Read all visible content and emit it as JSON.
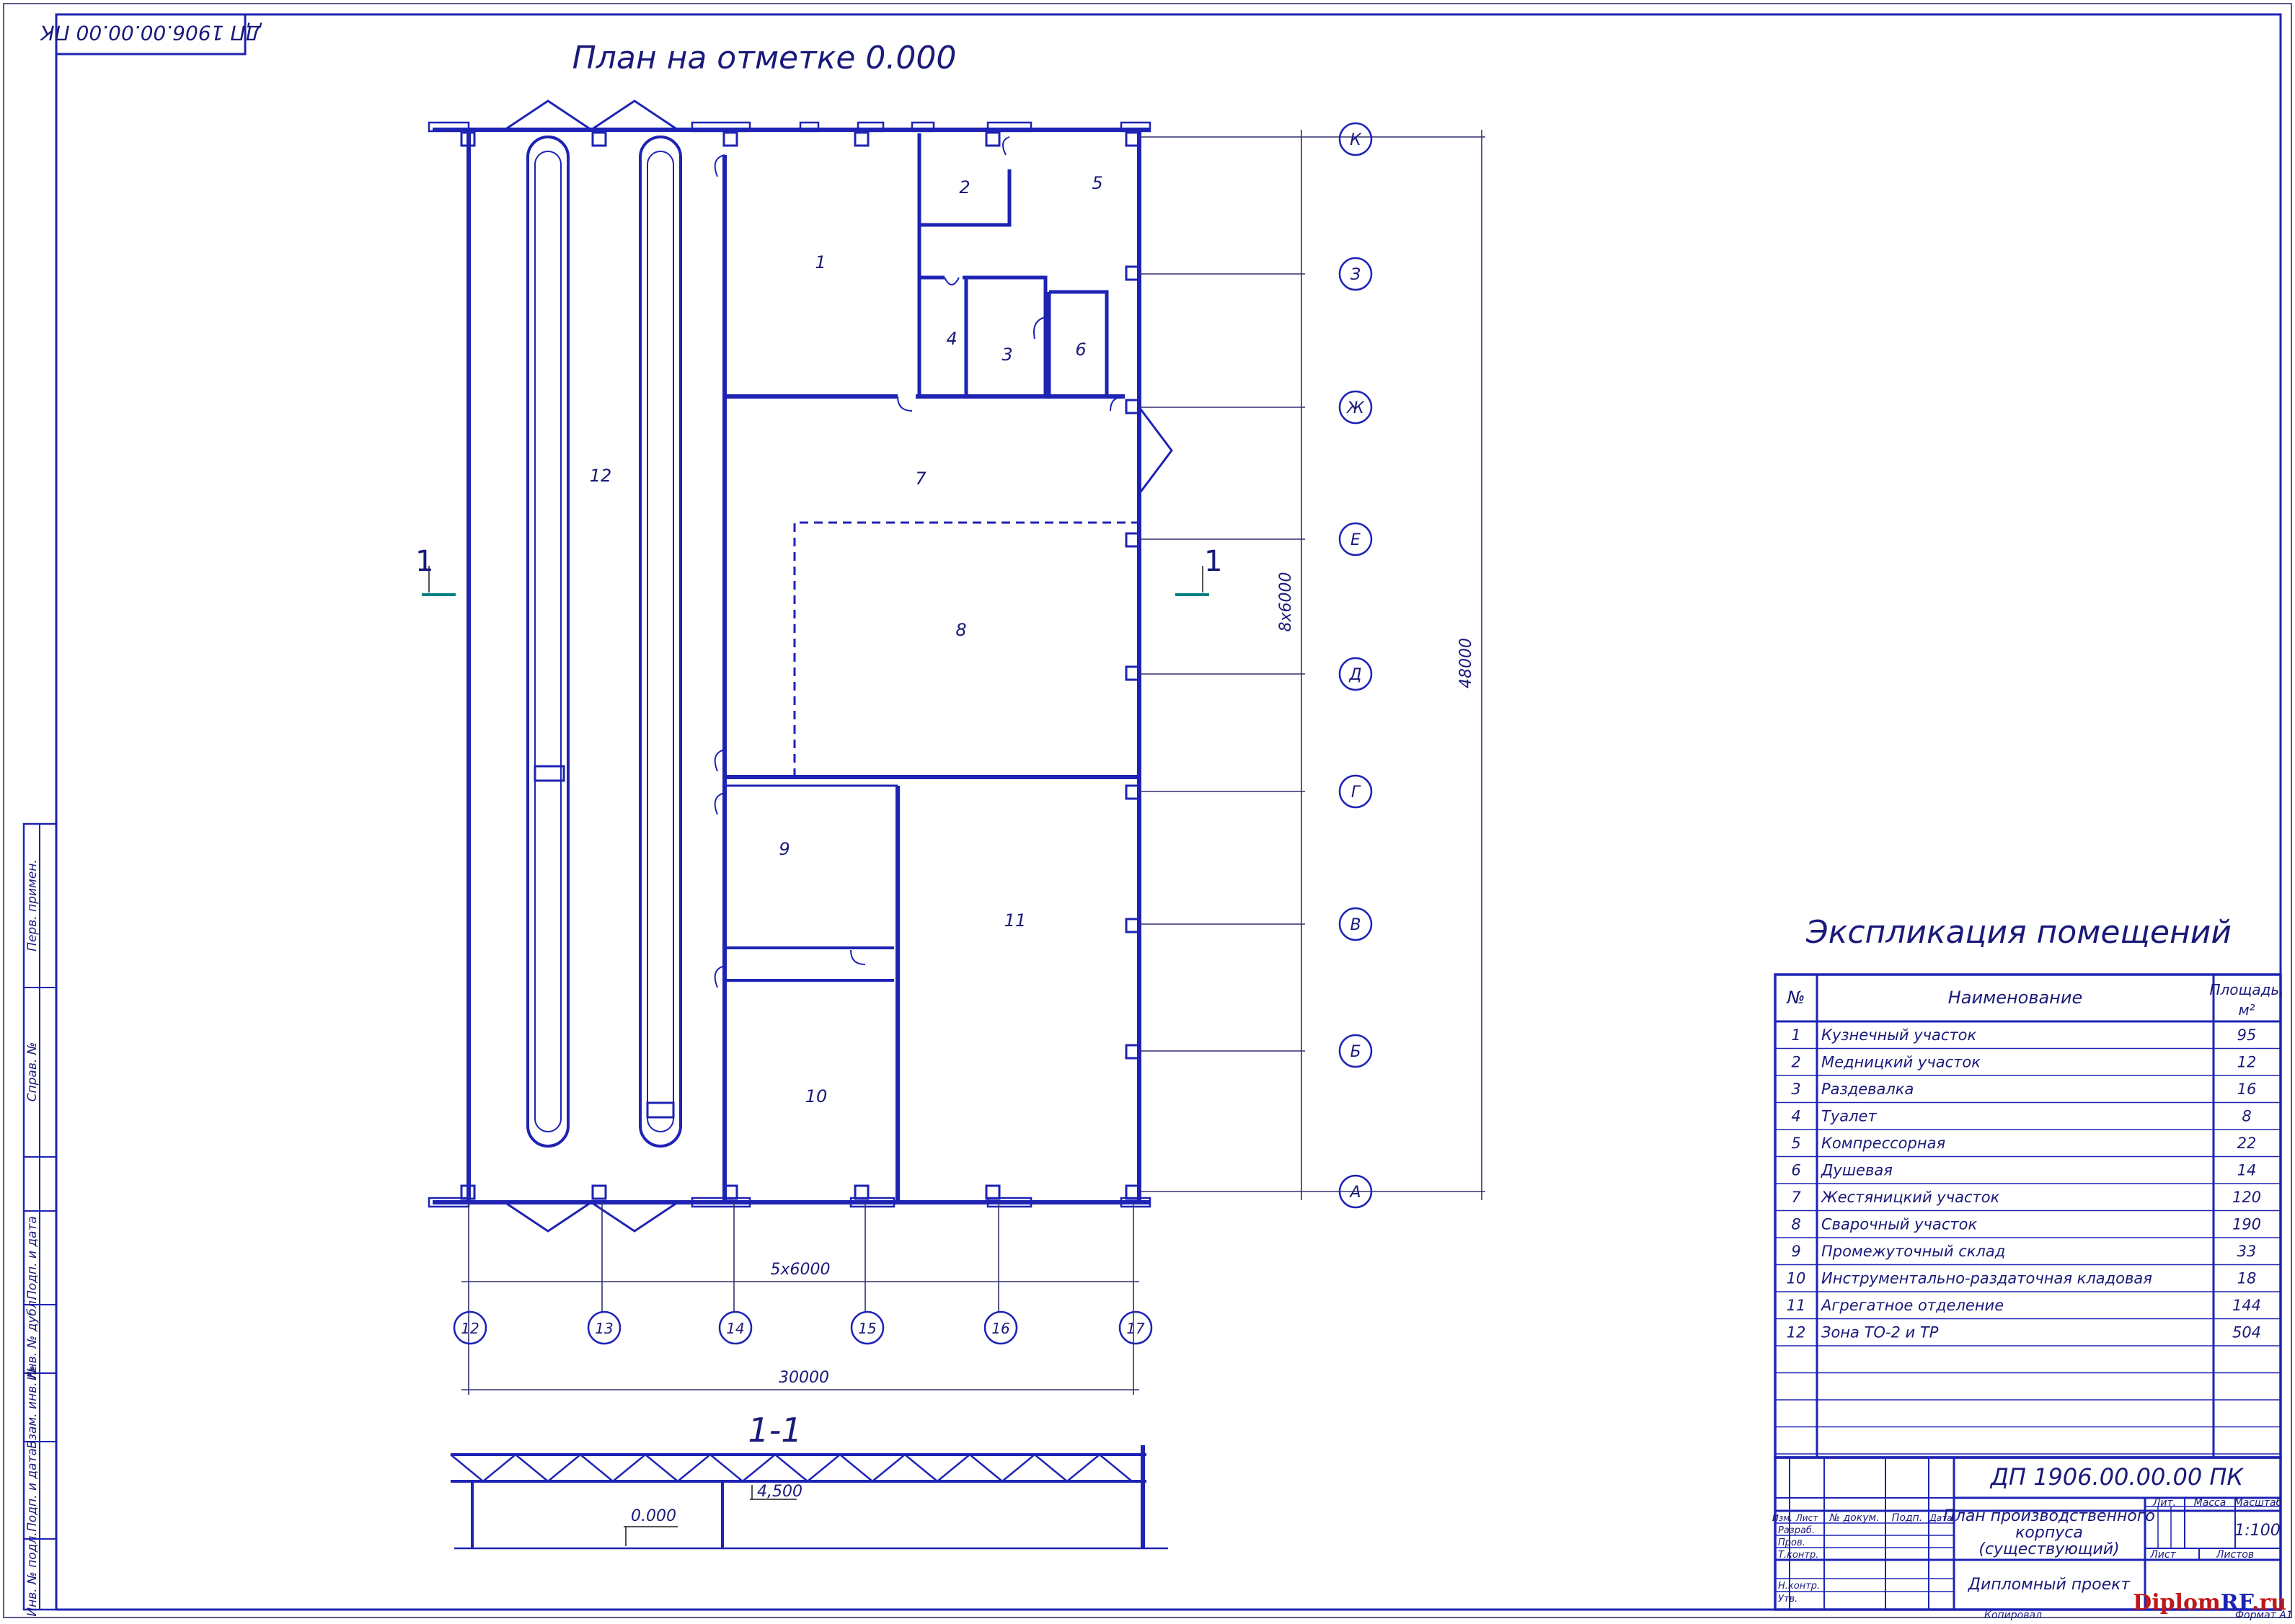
{
  "stamp_top": "ДП 1906.00.00.00 ПК",
  "plan_title": "План на отметке 0.000",
  "section_title": "1-1",
  "section_marks": {
    "left": "1",
    "right": "1"
  },
  "rooms": [
    "1",
    "2",
    "3",
    "4",
    "5",
    "6",
    "7",
    "8",
    "9",
    "10",
    "11",
    "12"
  ],
  "axes_letters": [
    "К",
    "З",
    "Ж",
    "Е",
    "Д",
    "Г",
    "В",
    "Б",
    "А"
  ],
  "axes_numbers": [
    "12",
    "13",
    "14",
    "15",
    "16",
    "17"
  ],
  "dimensions": {
    "span_step": "5х6000",
    "span_total": "30000",
    "height_step": "8х6000",
    "height_total": "48000"
  },
  "levels": {
    "floor": "0.000",
    "top": "4,500"
  },
  "side_stamps": [
    "Перв. примен.",
    "Справ. №",
    "Подп. и дата",
    "Инв. № дубл.",
    "Взам. инв. №",
    "Подп. и дата",
    "Инв. № подл."
  ],
  "explication": {
    "title": "Экспликация помещений",
    "headers": {
      "no": "№",
      "name": "Наименование",
      "area": "Площадь, м²"
    },
    "rows": [
      {
        "no": "1",
        "name": "Кузнечный участок",
        "area": "95"
      },
      {
        "no": "2",
        "name": "Медницкий участок",
        "area": "12"
      },
      {
        "no": "3",
        "name": "Раздевалка",
        "area": "16"
      },
      {
        "no": "4",
        "name": "Туалет",
        "area": "8"
      },
      {
        "no": "5",
        "name": "Компрессорная",
        "area": "22"
      },
      {
        "no": "6",
        "name": "Душевая",
        "area": "14"
      },
      {
        "no": "7",
        "name": "Жестяницкий участок",
        "area": "120"
      },
      {
        "no": "8",
        "name": "Сварочный участок",
        "area": "190"
      },
      {
        "no": "9",
        "name": "Промежуточный склад",
        "area": "33"
      },
      {
        "no": "10",
        "name": "Инструментально-раздаточная кладовая",
        "area": "18"
      },
      {
        "no": "11",
        "name": "Агрегатное отделение",
        "area": "144"
      },
      {
        "no": "12",
        "name": "Зона ТО-2 и ТР",
        "area": "504"
      }
    ]
  },
  "title_block": {
    "code": "ДП 1906.00.00.00 ПК",
    "name_line1": "План производственного",
    "name_line2": "корпуса",
    "name_line3": "(существующий)",
    "doc_type": "Дипломный проект",
    "col_headers": {
      "izm": "Изм.",
      "list": "Лист",
      "doc": "№ докум.",
      "sign": "Подп.",
      "date": "Дата"
    },
    "roles": [
      "Разраб.",
      "Пров.",
      "Т.контр.",
      "Н.контр.",
      "Утв."
    ],
    "lit": "Лит.",
    "mass": "Масса",
    "scale_label": "Масштаб",
    "scale": "1:100",
    "sheet": "Лист",
    "sheets": "Листов",
    "copied": "Копировал",
    "format": "Формат A1"
  },
  "watermark": {
    "a": "Diplom",
    "b": "RF",
    "c": ".ru"
  }
}
